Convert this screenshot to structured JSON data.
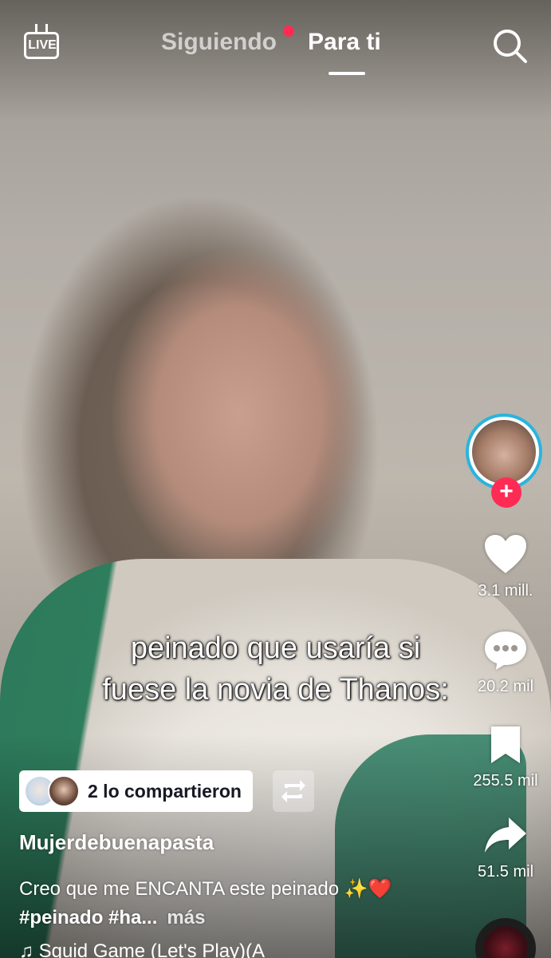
{
  "colors": {
    "accent": "#fe2c55",
    "avatar_ring": "#2ab4dd"
  },
  "header": {
    "live_label": "LIVE",
    "tabs": [
      {
        "label": "Siguiendo",
        "active": false,
        "has_notification_dot": true
      },
      {
        "label": "Para ti",
        "active": true
      }
    ],
    "search_icon": "search-icon"
  },
  "video": {
    "caption_line1": "peinado que usaría si",
    "caption_line2": "fuese la novia de Thanos:"
  },
  "rail": {
    "follow_icon": "plus-icon",
    "likes": "3.1 mill.",
    "comments": "20.2 mil",
    "saves": "255.5 mil",
    "shares": "51.5 mil"
  },
  "post": {
    "reposts_label": "2 lo compartieron",
    "username": "Mujerdebuenapasta",
    "description_text": "Creo que me ENCANTA este peinado ✨❤️ ",
    "hashtags": "#peinado #ha...",
    "more_label": "más",
    "music": "♫ Squid Game (Let's Play)(A"
  }
}
